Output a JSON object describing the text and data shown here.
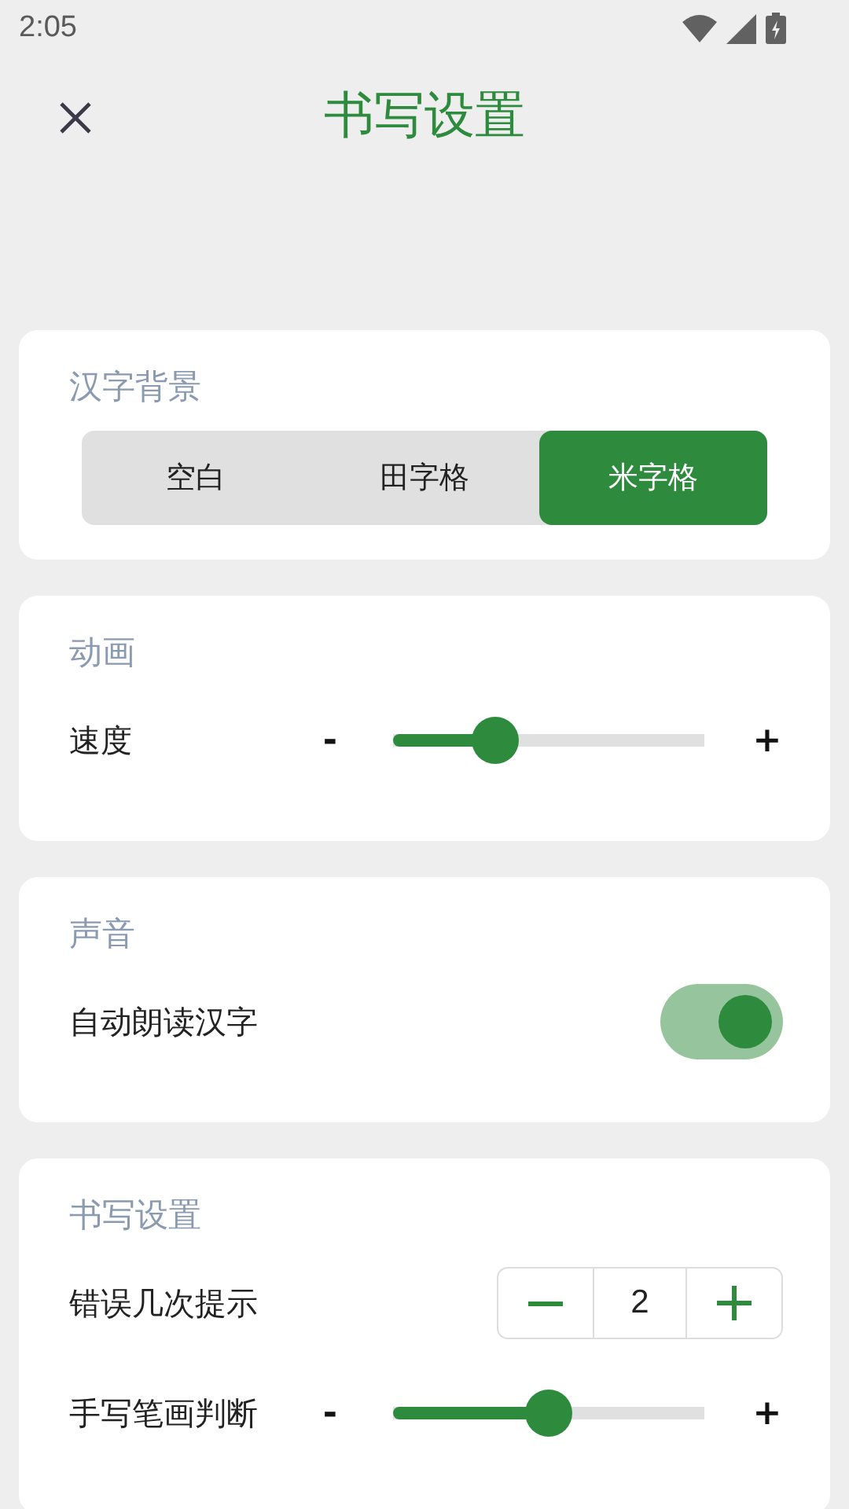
{
  "status_bar": {
    "time": "2:05"
  },
  "header": {
    "title": "书写设置"
  },
  "sections": [
    {
      "title": "汉字背景",
      "rows": [
        {
          "kind": "segmented",
          "options": [
            {
              "label": "空白",
              "selected": false
            },
            {
              "label": "田字格",
              "selected": false
            },
            {
              "label": "米字格",
              "selected": true
            }
          ]
        }
      ]
    },
    {
      "title": "动画",
      "rows": [
        {
          "kind": "slider",
          "label": "速度",
          "minus": "-",
          "plus": "+",
          "level": 0.33
        }
      ]
    },
    {
      "title": "声音",
      "rows": [
        {
          "kind": "switch",
          "label": "自动朗读汉字",
          "on": true
        }
      ]
    },
    {
      "title": "书写设置",
      "rows": [
        {
          "kind": "stepper",
          "label": "错误几次提示",
          "value": "2"
        },
        {
          "kind": "slider",
          "label": "手写笔画判断",
          "minus": "-",
          "plus": "+",
          "level": 0.5
        }
      ]
    }
  ]
}
